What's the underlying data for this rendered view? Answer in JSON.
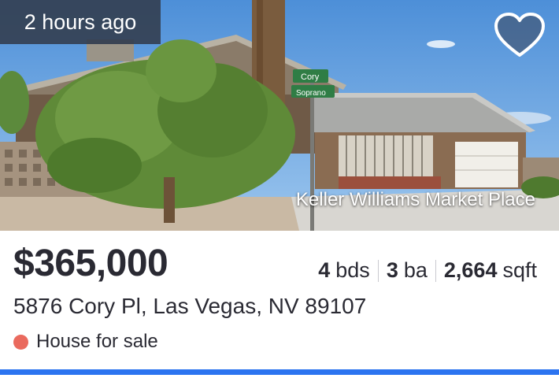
{
  "listing": {
    "posted_ago": "2 hours ago",
    "broker": "Keller Williams Market Place",
    "price": "$365,000",
    "facts": {
      "beds_value": "4",
      "beds_unit": "bds",
      "baths_value": "3",
      "baths_unit": "ba",
      "sqft_value": "2,664",
      "sqft_unit": "sqft"
    },
    "address": "5876 Cory Pl, Las Vegas, NV 89107",
    "status": "House for sale",
    "street_signs": [
      "Cory",
      "Soprano"
    ]
  },
  "icons": {
    "favorite": "heart-outline-icon",
    "status": "status-dot"
  },
  "colors": {
    "status_dot": "#ea6a5e",
    "accent_bar": "#2c74f0",
    "badge_bg": "#344052",
    "text": "#2a2a33"
  }
}
